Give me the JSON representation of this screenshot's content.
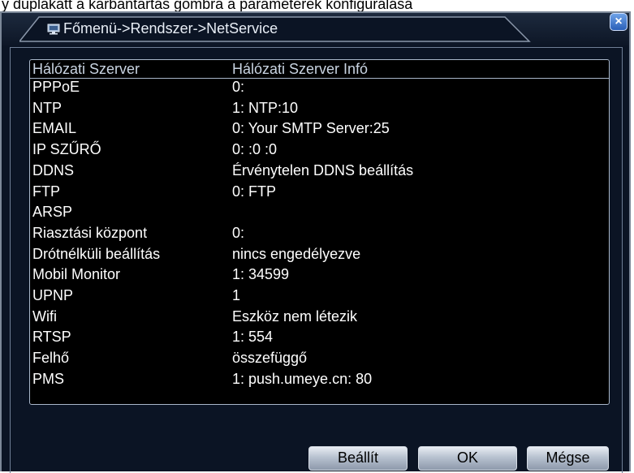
{
  "caption": "y duplakatt a karbantartás gombra a paraméterek konfigurálásá",
  "window": {
    "title": "Főmenü->Rendszer->NetService",
    "close_label": "×"
  },
  "table": {
    "headers": [
      "Hálózati Szerver",
      "Hálózati Szerver Infó"
    ],
    "rows": [
      {
        "name": "PPPoE",
        "info": "0:"
      },
      {
        "name": "NTP",
        "info": "1: NTP:10"
      },
      {
        "name": "EMAIL",
        "info": "0: Your SMTP Server:25"
      },
      {
        "name": "IP SZŰRŐ",
        "info": "0: :0 :0"
      },
      {
        "name": "DDNS",
        "info": "Érvénytelen DDNS beállítás"
      },
      {
        "name": "FTP",
        "info": "0: FTP"
      },
      {
        "name": "ARSP",
        "info": ""
      },
      {
        "name": "Riasztási központ",
        "info": "0:"
      },
      {
        "name": "Drótnélküli beállítás",
        "info": "nincs engedélyezve"
      },
      {
        "name": "Mobil Monitor",
        "info": "1: 34599"
      },
      {
        "name": "UPNP",
        "info": "1"
      },
      {
        "name": "Wifi",
        "info": "Eszköz nem létezik"
      },
      {
        "name": "RTSP",
        "info": "1: 554"
      },
      {
        "name": "Felhő",
        "info": "összefüggő"
      },
      {
        "name": "PMS",
        "info": "1: push.umeye.cn: 80"
      }
    ]
  },
  "buttons": {
    "set": "Beállít",
    "ok": "OK",
    "cancel": "Mégse"
  },
  "colors": {
    "background": "#0b1424",
    "list_background": "#000000",
    "text": "#ffffff",
    "close_button": "#2a5fb8"
  },
  "icons": {
    "title": "monitor-icon",
    "close": "close-icon"
  }
}
